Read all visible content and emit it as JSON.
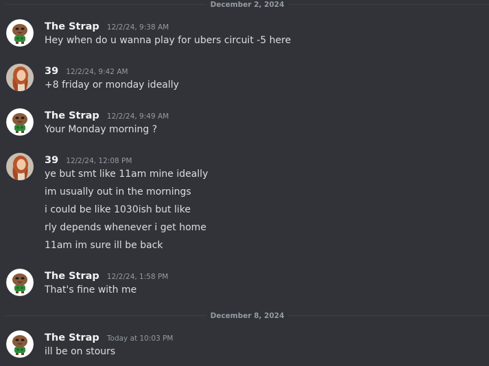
{
  "dividers": [
    "December 2, 2024",
    "December 8, 2024"
  ],
  "messages": [
    {
      "author": "The Strap",
      "time": "12/2/24, 9:38 AM",
      "lines": [
        "Hey when do u wanna play for ubers circuit -5 here"
      ]
    },
    {
      "author": "39",
      "time": "12/2/24, 9:42 AM",
      "lines": [
        "+8 friday or monday ideally"
      ]
    },
    {
      "author": "The Strap",
      "time": "12/2/24, 9:49 AM",
      "lines": [
        "Your Monday morning ?"
      ]
    },
    {
      "author": "39",
      "time": "12/2/24, 12:08 PM",
      "lines": [
        "ye but smt like 11am mine ideally",
        "im usually out in the mornings",
        "i could be like 1030ish but like",
        "rly depends whenever i get home",
        "11am im sure ill be back"
      ]
    },
    {
      "author": "The Strap",
      "time": "12/2/24, 1:58 PM",
      "lines": [
        "That's fine with me"
      ]
    },
    {
      "author": "The Strap",
      "time": "Today at 10:03 PM",
      "lines": [
        "ill be on stours"
      ]
    }
  ],
  "colors": {
    "background": "#313338",
    "username": "#f2f3f5",
    "message_text": "#dbdee1",
    "timestamp": "#949ba4",
    "divider": "#3f4147"
  },
  "icons": {
    "strap_avatar": "brown-potato-character-in-green-shirt",
    "user39_avatar": "photo-of-person-with-red-hair"
  }
}
